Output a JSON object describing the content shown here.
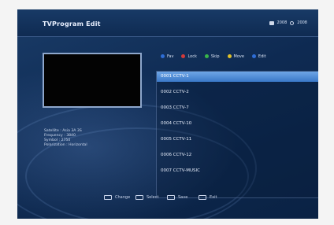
{
  "header": {
    "title": "TVProgram Edit",
    "date": "2008",
    "time": "2008"
  },
  "info": {
    "satellite": "Satellite : Asia 3A 3S",
    "frequency": "Frequency : 3840",
    "symbol": "Symbol : 2750",
    "polarization": "Polarization : Horizontal"
  },
  "color_keys": [
    {
      "label": "Fav",
      "color": "#2e6dd6"
    },
    {
      "label": "Lock",
      "color": "#d23a3a"
    },
    {
      "label": "Skip",
      "color": "#39b54a"
    },
    {
      "label": "Move",
      "color": "#e0c12a"
    },
    {
      "label": "Edit",
      "color": "#2e6dd6"
    }
  ],
  "channels": [
    {
      "label": "0001 CCTV-1",
      "selected": true
    },
    {
      "label": "0002 CCTV-2",
      "selected": false
    },
    {
      "label": "0003 CCTV-7",
      "selected": false
    },
    {
      "label": "0004 CCTV-10",
      "selected": false
    },
    {
      "label": "0005 CCTV-11",
      "selected": false
    },
    {
      "label": "0006 CCTV-12",
      "selected": false
    },
    {
      "label": "0007 CCTV-MUSIC",
      "selected": false
    }
  ],
  "bottom_keys": [
    {
      "label": "Change"
    },
    {
      "label": "Select"
    },
    {
      "label": "Save"
    },
    {
      "label": "Exit"
    }
  ]
}
